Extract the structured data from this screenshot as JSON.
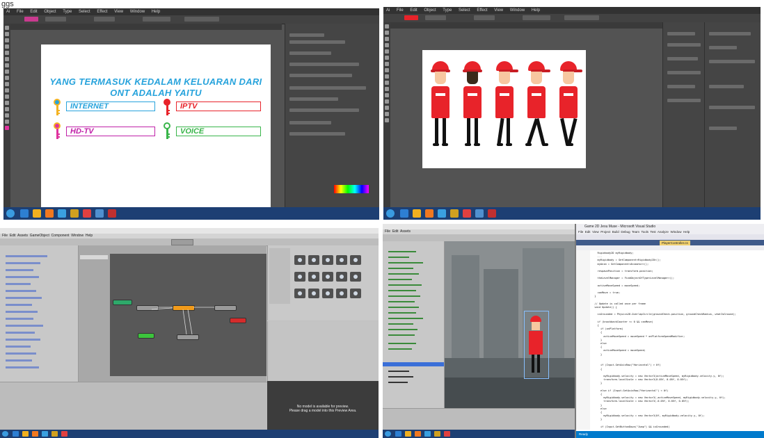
{
  "page_label": "ggs",
  "illustrator_menu": [
    "Ai",
    "File",
    "Edit",
    "Object",
    "Type",
    "Select",
    "Effect",
    "View",
    "Window",
    "Help"
  ],
  "artboard1": {
    "title_line1": "YANG TERMASUK KEDALAM KELUARAN DARI",
    "title_line2": "ONT ADALAH YAITU",
    "items": [
      {
        "label": "INTERNET",
        "color": "#27a3dc",
        "key_color": "#f4b323"
      },
      {
        "label": "IPTV",
        "color": "#e8232a",
        "key_color": "#e8232a"
      },
      {
        "label": "HD-TV",
        "color": "#c020a8",
        "key_color": "#e0329e"
      },
      {
        "label": "VOICE",
        "color": "#39b54a",
        "key_color": "#39b54a"
      }
    ]
  },
  "artboard2": {
    "figure_count": 5,
    "helmet_color": "#e8232a",
    "pants_color": "#111111"
  },
  "unity": {
    "menu": [
      "File",
      "Edit",
      "Assets",
      "GameObject",
      "Component",
      "Window",
      "Help"
    ],
    "preview_text": "No model is available for preview.",
    "preview_hint": "Please drag a model into this Preview Area.",
    "nodes": [
      {
        "color": "#2ea96a"
      },
      {
        "color": "#9a9a9a"
      },
      {
        "color": "#f29b1a"
      },
      {
        "color": "#9a9a9a"
      },
      {
        "color": "#d42b2b"
      },
      {
        "color": "#3cc43c"
      },
      {
        "color": "#9a9a9a"
      }
    ]
  },
  "vs": {
    "window_title": "Game 2D Jesu Muse - Microsoft Visual Studio",
    "menu": [
      "File",
      "Edit",
      "View",
      "Project",
      "Build",
      "Debug",
      "Team",
      "Tools",
      "Test",
      "Analyze",
      "Window",
      "Help"
    ],
    "tab_active": "PlayerController.cs",
    "status": "Ready",
    "code_lines": [
      {
        "text": "    Rigidbody2D myRigidbody;"
      },
      {
        "text": "    ..."
      },
      {
        "text": "    myRigidbody = GetComponent<Rigidbody2D>();"
      },
      {
        "text": "    myAnim = GetComponent<Animator>();"
      },
      {
        "text": ""
      },
      {
        "text": "    respawnPosition = transform.position;"
      },
      {
        "text": ""
      },
      {
        "text": "    theLevelManager = FindObjectOfType<LevelManager>();"
      },
      {
        "text": ""
      },
      {
        "text": "    activeMoveSpeed = moveSpeed;"
      },
      {
        "text": ""
      },
      {
        "text": "    canMove = true;"
      },
      {
        "text": "  }"
      },
      {
        "text": ""
      },
      {
        "text": "  // Update is called once per frame"
      },
      {
        "text": "  void Update() {"
      },
      {
        "text": ""
      },
      {
        "text": "    isGrounded = Physics2D.OverlapCircle(groundCheck.position, groundCheckRadius, whatIsGround);"
      },
      {
        "text": ""
      },
      {
        "text": "    if (knockbackCounter <= 0 && canMove)"
      },
      {
        "text": "    {"
      },
      {
        "text": "      if (onPlatform)"
      },
      {
        "text": "      {"
      },
      {
        "text": "        activeMoveSpeed = moveSpeed * onPlatformSpeedModifier;"
      },
      {
        "text": "      }"
      },
      {
        "text": "      else"
      },
      {
        "text": "      {"
      },
      {
        "text": "        activeMoveSpeed = moveSpeed;"
      },
      {
        "text": "      }"
      },
      {
        "text": ""
      },
      {
        "text": ""
      },
      {
        "text": "      if (Input.GetAxisRaw(\"Horizontal\") > 0f)"
      },
      {
        "text": "      {"
      },
      {
        "text": ""
      },
      {
        "text": "        myRigidbody.velocity = new Vector3(activeMoveSpeed, myRigidbody.velocity.y, 0f);"
      },
      {
        "text": "        transform.localScale = new Vector3(0.05f, 0.05f, 0.05f);"
      },
      {
        "text": "      }"
      },
      {
        "text": ""
      },
      {
        "text": "      else if (Input.GetAxisRaw(\"Horizontal\") < 0f)"
      },
      {
        "text": "      {"
      },
      {
        "text": "        myRigidbody.velocity = new Vector3(-activeMoveSpeed, myRigidbody.velocity.y, 0f);"
      },
      {
        "text": "        transform.localScale = new Vector3(-0.05f, 0.05f, 0.05f);"
      },
      {
        "text": "      }"
      },
      {
        "text": "      else"
      },
      {
        "text": "      {"
      },
      {
        "text": "        myRigidbody.velocity = new Vector3(0f, myRigidbody.velocity.y, 0f);"
      },
      {
        "text": "      }"
      },
      {
        "text": ""
      },
      {
        "text": "      if (Input.GetButtonDown(\"Jump\") && isGrounded)"
      }
    ]
  }
}
